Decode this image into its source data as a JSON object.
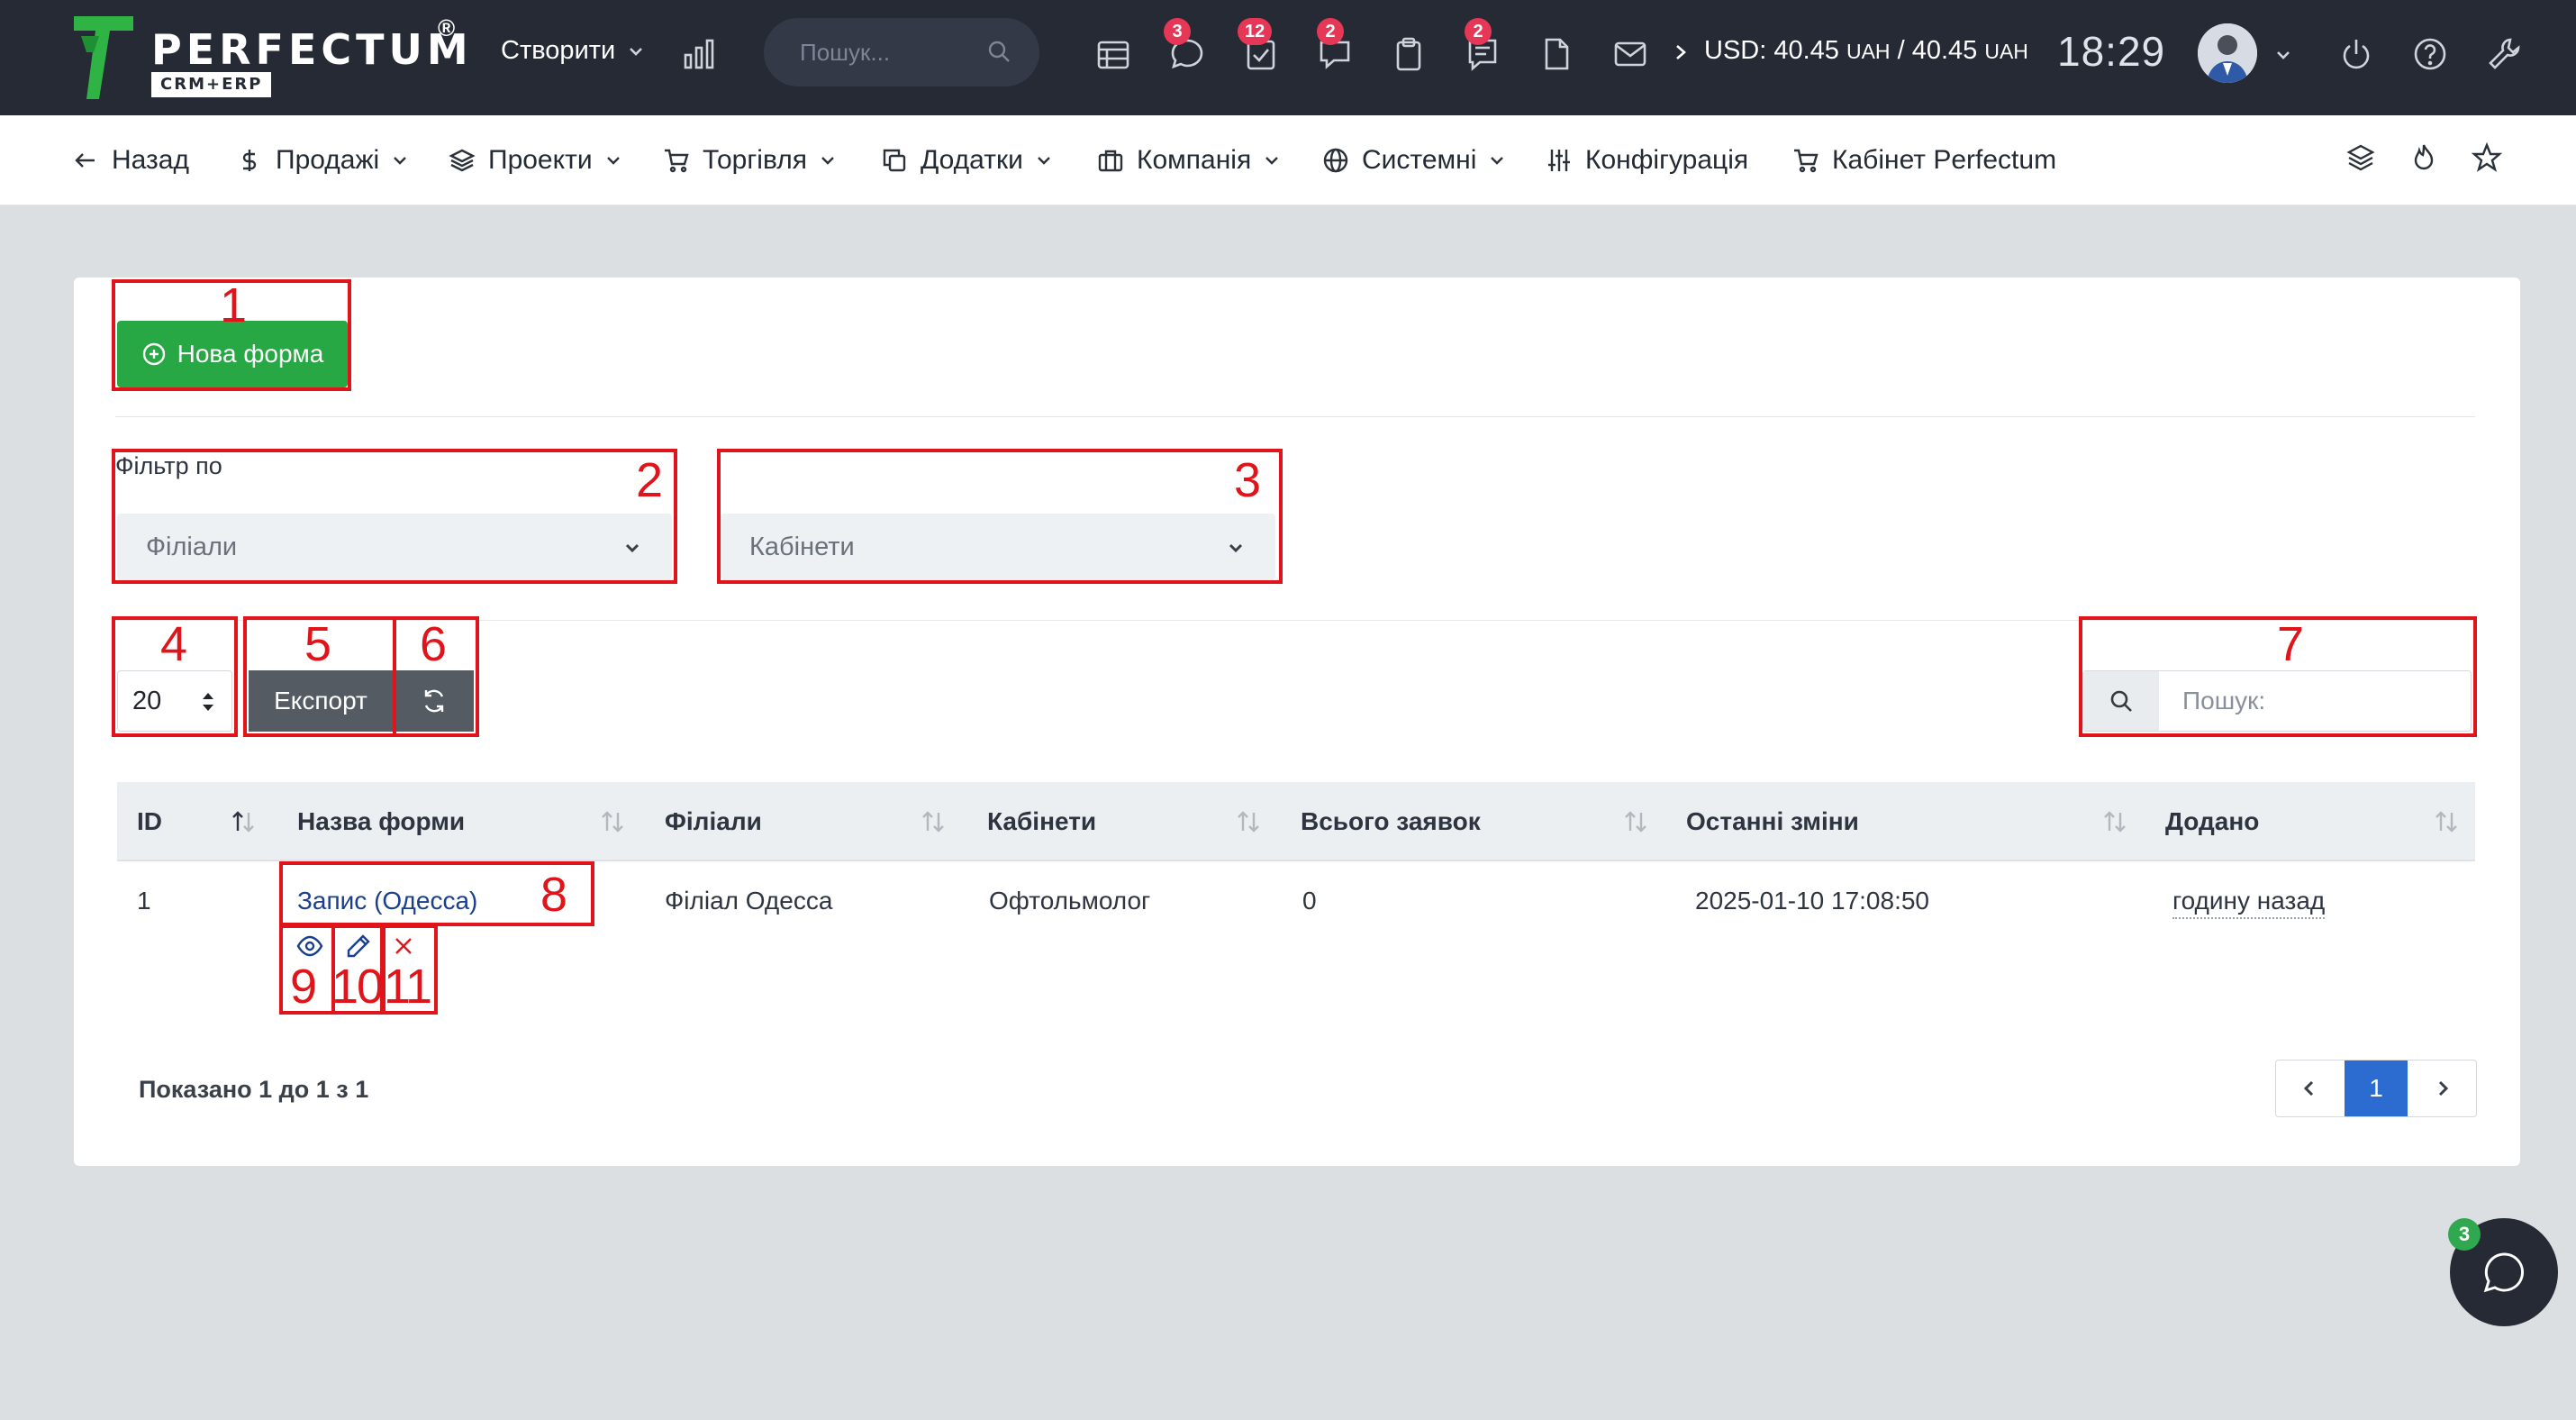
{
  "topbar": {
    "logo_text": "PERFECTUM",
    "logo_reg": "®",
    "logo_sub": "CRM+ERP",
    "create_label": "Створити",
    "search_placeholder": "Пошук...",
    "badges": {
      "chat": "3",
      "tasks": "12",
      "discussions": "2",
      "notes": "2"
    },
    "usd_prefix": "USD: 40.45",
    "usd_unit1": "UAH",
    "usd_sep": " / 40.45",
    "usd_unit2": "UAH",
    "clock": "18:29"
  },
  "nav": {
    "back": "Назад",
    "sales": "Продажі",
    "projects": "Проекти",
    "trade": "Торгівля",
    "addons": "Додатки",
    "company": "Компанія",
    "system": "Системні",
    "config": "Конфігурація",
    "cabinet": "Кабінет Perfectum"
  },
  "toolbar": {
    "new_form": "Нова форма"
  },
  "filter": {
    "label": "Фільтр по",
    "branches_placeholder": "Філіали",
    "cabinets_placeholder": "Кабінети"
  },
  "table_controls": {
    "page_size": "20",
    "export_label": "Експорт",
    "search_placeholder": "Пошук:"
  },
  "table": {
    "columns": [
      "ID",
      "Назва форми",
      "Філіали",
      "Кабінети",
      "Всього заявок",
      "Останні зміни",
      "Додано"
    ],
    "rows": [
      {
        "id": "1",
        "name": "Запис (Одесса)",
        "branch": "Філіал Одесса",
        "cabinet": "Офтольмолог",
        "total": "0",
        "last_change": "2025-01-10 17:08:50",
        "added": "годину назад"
      }
    ]
  },
  "footer": {
    "showing": "Показано 1 до 1 з 1",
    "current_page": "1"
  },
  "chat": {
    "badge": "3"
  },
  "annotations": [
    "1",
    "2",
    "3",
    "4",
    "5",
    "6",
    "7",
    "8",
    "9",
    "10",
    "11"
  ],
  "colors": {
    "topbar": "#252a35",
    "primary_green": "#28a745",
    "pager_active": "#2c6bd0",
    "badge_red": "#e63757",
    "annotation_red": "#e0151b"
  }
}
